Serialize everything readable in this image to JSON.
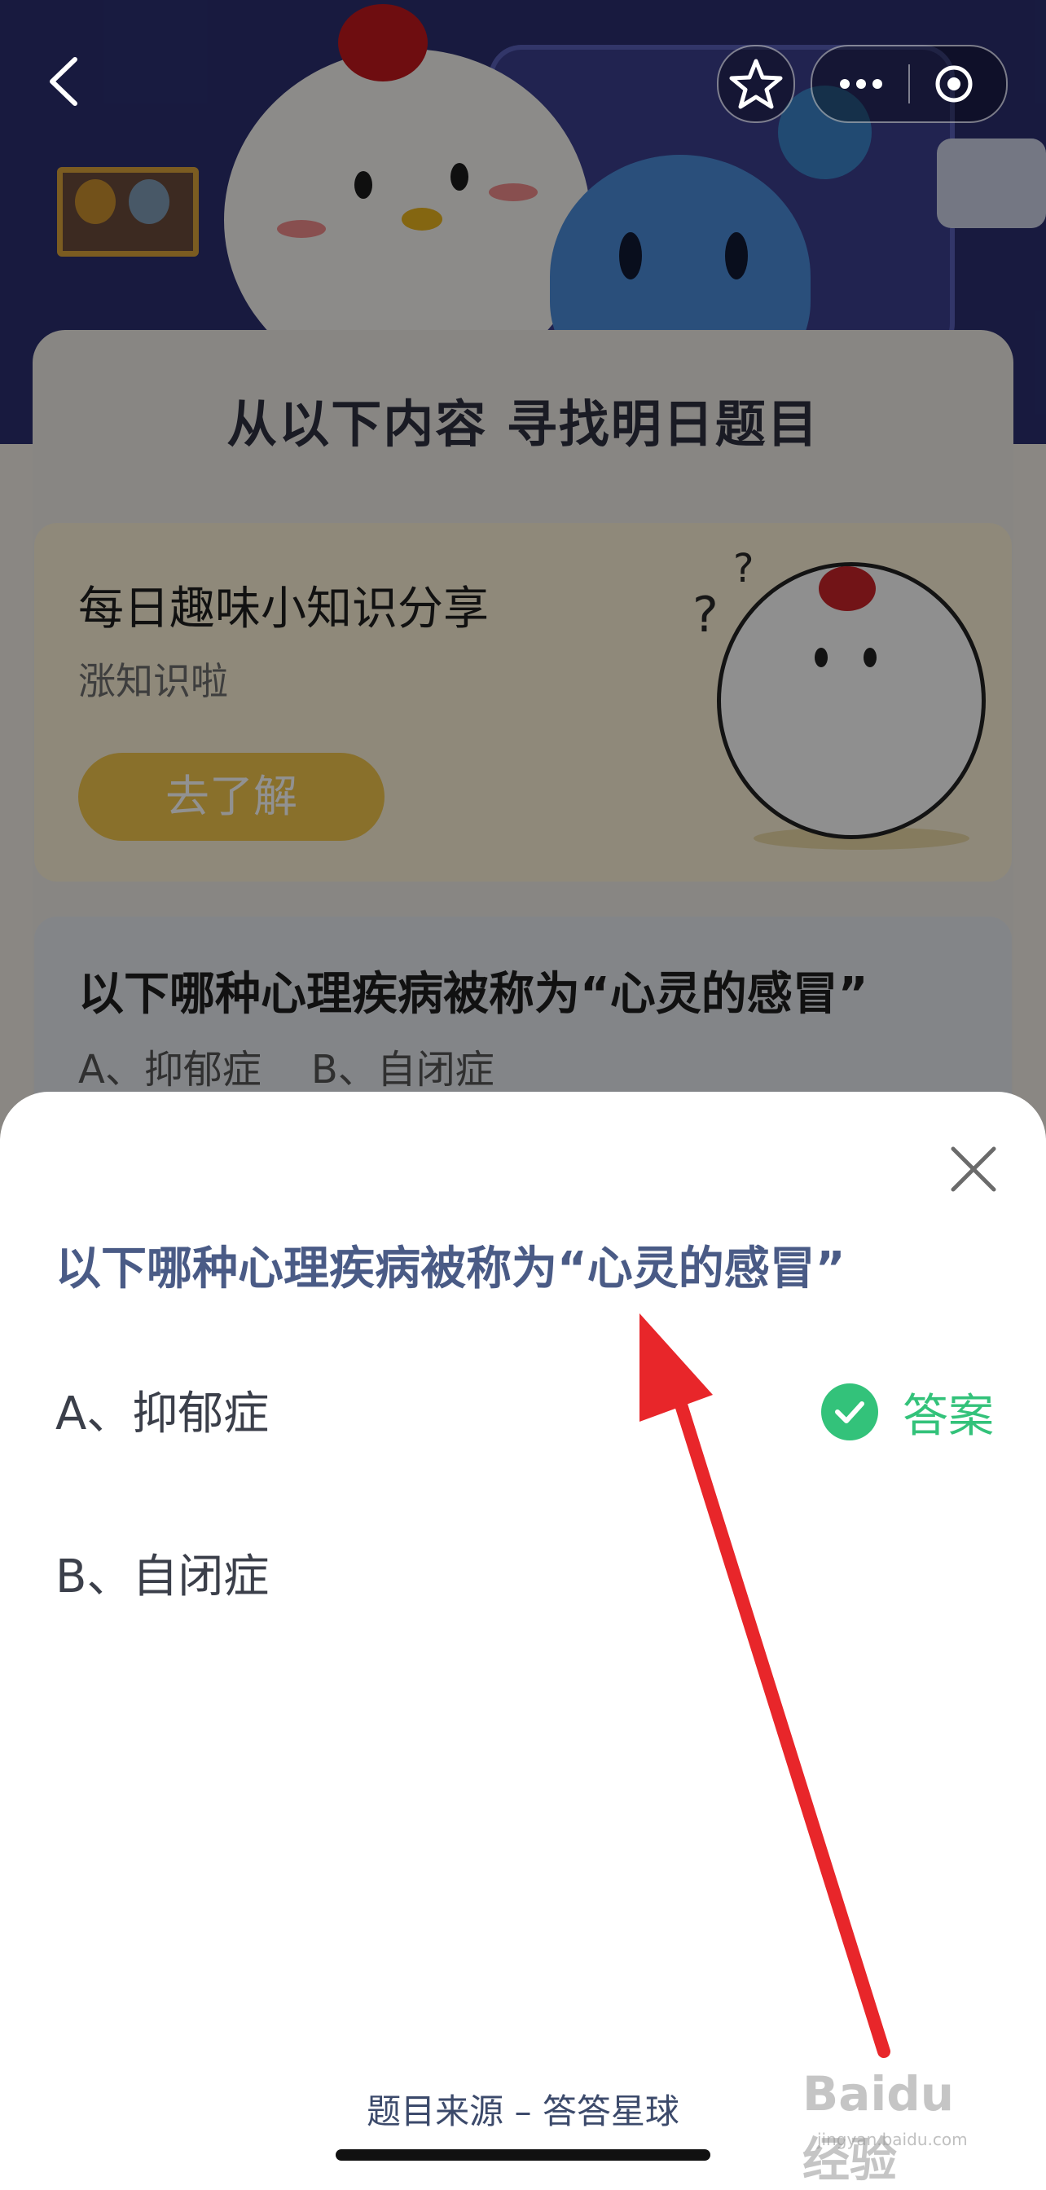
{
  "board": {
    "title": "从以下内容  寻找明日题目"
  },
  "daily_card": {
    "title": "每日趣味小知识分享",
    "subtitle": "涨知识啦",
    "button_label": "去了解"
  },
  "question_card": {
    "title": "以下哪种心理疾病被称为“心灵的感冒”",
    "options_line": "A、抑郁症    B、自闭症"
  },
  "sheet": {
    "question": "以下哪种心理疾病被称为“心灵的感冒”",
    "options": [
      {
        "label": "A、抑郁症",
        "is_answer": true
      },
      {
        "label": "B、自闭症",
        "is_answer": false
      }
    ],
    "answer_label": "答案",
    "source": "题目来源 – 答答星球"
  },
  "watermark": {
    "text": "Baidu经验",
    "sub": "jingyan.baidu.com"
  },
  "colors": {
    "accent_question": "#4a5b86",
    "answer_green": "#33c27a",
    "annotation_arrow": "#e8262a"
  }
}
